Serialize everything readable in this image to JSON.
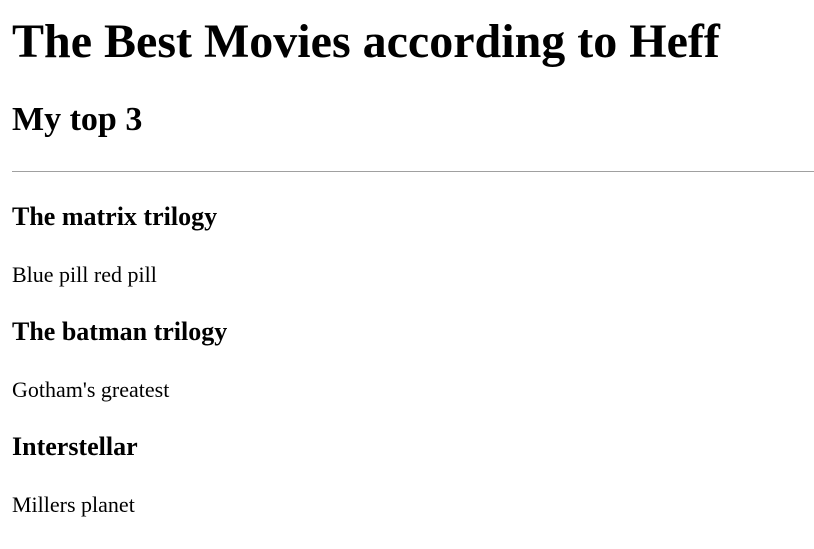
{
  "page": {
    "title": "The Best Movies according to Heff",
    "subtitle": "My top 3"
  },
  "movies": [
    {
      "title": "The matrix trilogy",
      "description": "Blue pill red pill"
    },
    {
      "title": "The batman trilogy",
      "description": "Gotham's greatest"
    },
    {
      "title": "Interstellar",
      "description": "Millers planet"
    }
  ]
}
